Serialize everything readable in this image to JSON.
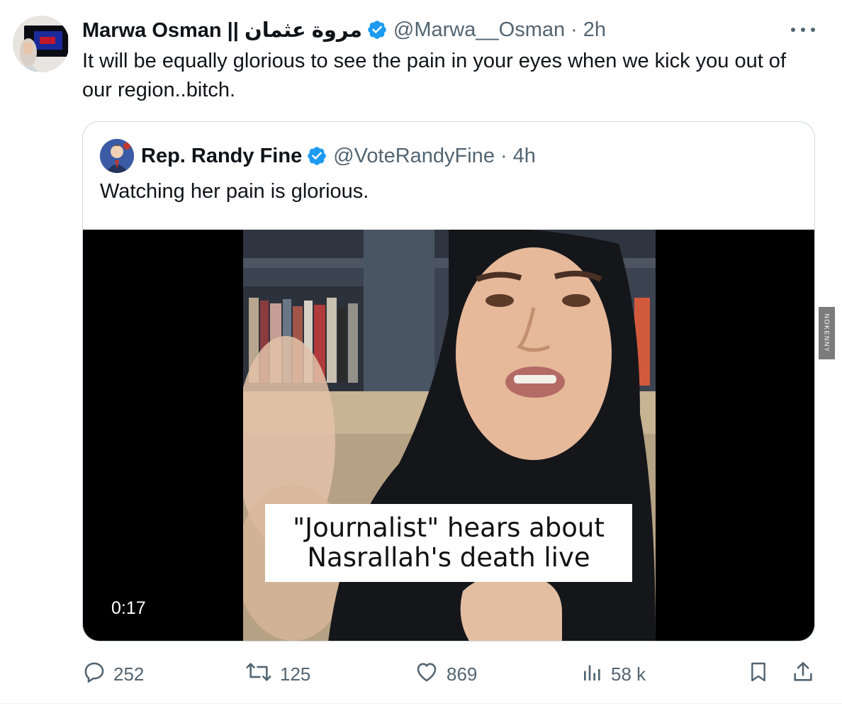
{
  "tweet": {
    "display_name": "Marwa Osman || مروة عثمان",
    "handle": "@Marwa__Osman",
    "time": "2h",
    "text": "It will be equally glorious to see the pain in your eyes when we kick you out of our region..bitch.",
    "more_icon": "more-horizontal-icon"
  },
  "quoted": {
    "display_name": "Rep. Randy Fine",
    "handle": "@VoteRandyFine",
    "time": "4h",
    "text": "Watching her pain is glorious.",
    "video": {
      "caption_line1": "\"Journalist\" hears about",
      "caption_line2": "Nasrallah's death live",
      "duration": "0:17"
    }
  },
  "actions": {
    "replies": "252",
    "reposts": "125",
    "likes": "869",
    "views": "58 k"
  },
  "watermark": "NOKENNY",
  "colors": {
    "verified": "#1d9bf0",
    "text": "#0f1419",
    "secondary": "#536471",
    "border": "#cfd9de"
  }
}
